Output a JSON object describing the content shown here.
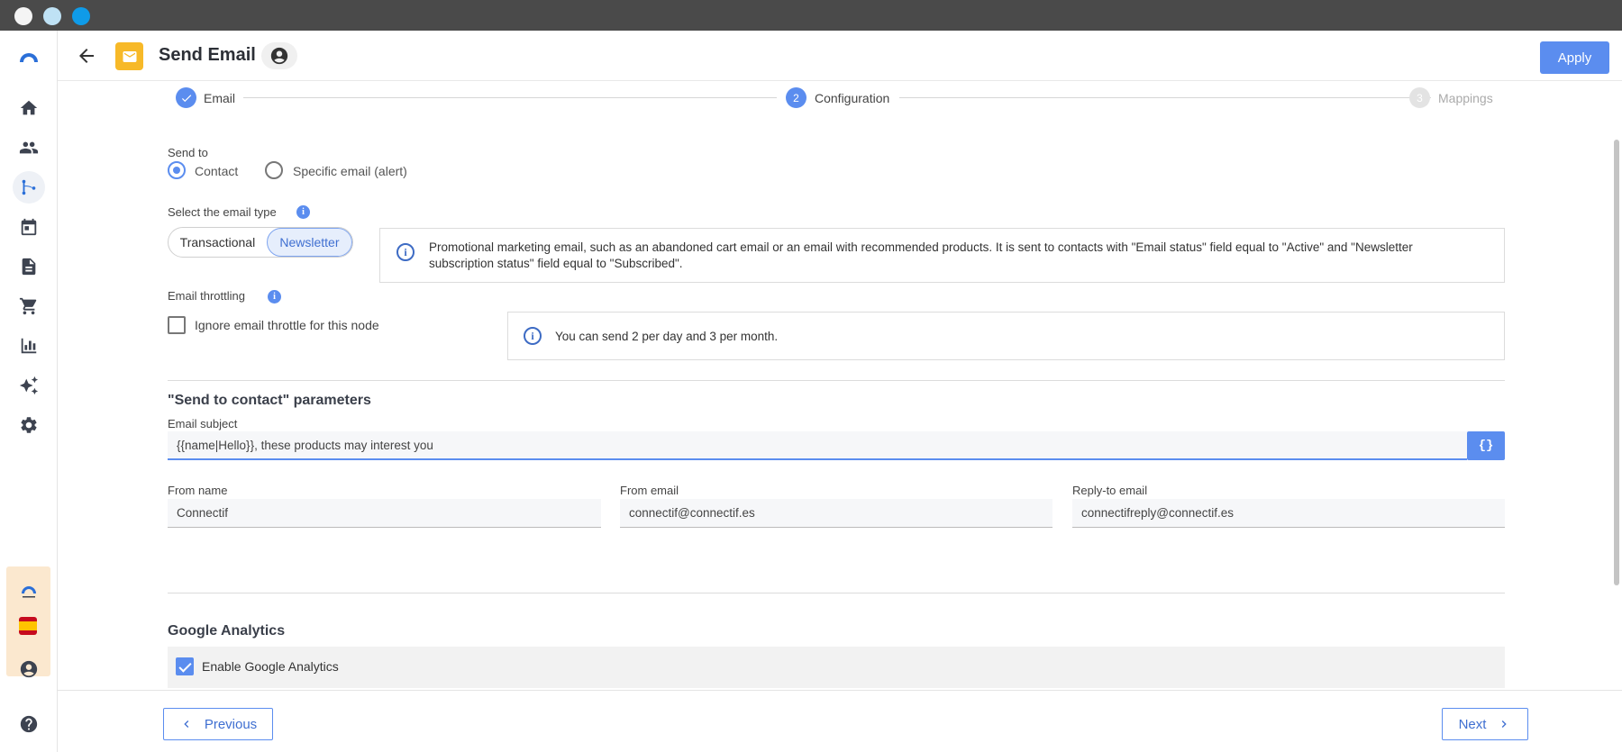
{
  "window": {
    "dots": [
      "#f4f4f4",
      "#bfe2f5",
      "#0f9be8"
    ]
  },
  "sidebar": {
    "logo": "connectif-logo",
    "items": [
      {
        "icon": "home-icon",
        "name": "sidebar-item-home"
      },
      {
        "icon": "people-icon",
        "name": "sidebar-item-contacts"
      },
      {
        "icon": "workflow-icon",
        "name": "sidebar-item-workflows",
        "active": true
      },
      {
        "icon": "calendar-icon",
        "name": "sidebar-item-calendar"
      },
      {
        "icon": "document-icon",
        "name": "sidebar-item-content"
      },
      {
        "icon": "cart-icon",
        "name": "sidebar-item-store"
      },
      {
        "icon": "bar-chart-icon",
        "name": "sidebar-item-reports"
      },
      {
        "icon": "sparkles-icon",
        "name": "sidebar-item-ai"
      },
      {
        "icon": "gear-icon",
        "name": "sidebar-item-settings"
      }
    ],
    "account_flag": "spain-flag-icon"
  },
  "header": {
    "title": "Send Email",
    "apply_label": "Apply"
  },
  "stepper": {
    "steps": [
      {
        "number": "✓",
        "label": "Email",
        "state": "done"
      },
      {
        "number": "2",
        "label": "Configuration",
        "state": "current"
      },
      {
        "number": "3",
        "label": "Mappings",
        "state": "pending"
      }
    ]
  },
  "form": {
    "send_to": {
      "label": "Send to",
      "options": [
        "Contact",
        "Specific email (alert)"
      ],
      "selected": "Contact"
    },
    "email_type": {
      "label": "Select the email type",
      "options": [
        "Transactional",
        "Newsletter"
      ],
      "selected": "Newsletter",
      "info": "Promotional marketing email, such as an abandoned cart email or an email with recommended products. It is sent to contacts with \"Email status\" field equal to \"Active\" and \"Newsletter subscription status\" field equal to \"Subscribed\"."
    },
    "throttling": {
      "label": "Email throttling",
      "checkbox_label": "Ignore email throttle for this node",
      "checked": false,
      "info": "You can send 2 per day and 3 per month."
    },
    "params": {
      "title": "\"Send to contact\" parameters",
      "subject_label": "Email subject",
      "subject_value": "{{name|Hello}}, these products may interest you",
      "braces_label": "{}",
      "from_name_label": "From name",
      "from_name_value": "Connectif",
      "from_email_label": "From email",
      "from_email_value": "connectif@connectif.es",
      "reply_to_label": "Reply-to email",
      "reply_to_value": "connectifreply@connectif.es"
    },
    "analytics": {
      "title": "Google Analytics",
      "checkbox_label": "Enable Google Analytics",
      "checked": true
    }
  },
  "footer": {
    "previous_label": "Previous",
    "next_label": "Next"
  },
  "colors": {
    "accent": "#5b8def",
    "titlebar": "#4a4a4a",
    "email_icon_bg": "#f7b928"
  }
}
